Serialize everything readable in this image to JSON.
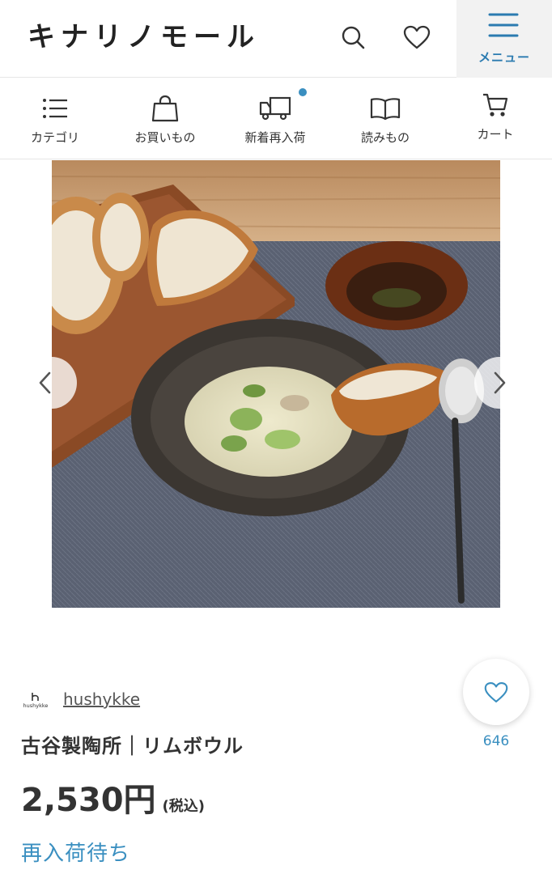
{
  "header": {
    "logo": "キナリノモール",
    "menu_label": "メニュー"
  },
  "nav": {
    "items": [
      {
        "label": "カテゴリ",
        "icon": "list-icon"
      },
      {
        "label": "お買いもの",
        "icon": "shopping-bag-icon"
      },
      {
        "label": "新着再入荷",
        "icon": "truck-icon",
        "has_badge": true
      },
      {
        "label": "読みもの",
        "icon": "book-icon"
      },
      {
        "label": "カート",
        "icon": "cart-icon"
      }
    ]
  },
  "product": {
    "image_alt": "food photo",
    "brand_logo_text": "hushykke",
    "brand": "hushykke",
    "title": "古谷製陶所｜リムボウル",
    "price": "2,530円",
    "tax_note": "(税込)",
    "status": "再入荷待ち",
    "favorite_count": "646"
  },
  "colors": {
    "accent": "#3a8fc0",
    "text": "#333333",
    "menu_bg": "#f2f2f2"
  }
}
